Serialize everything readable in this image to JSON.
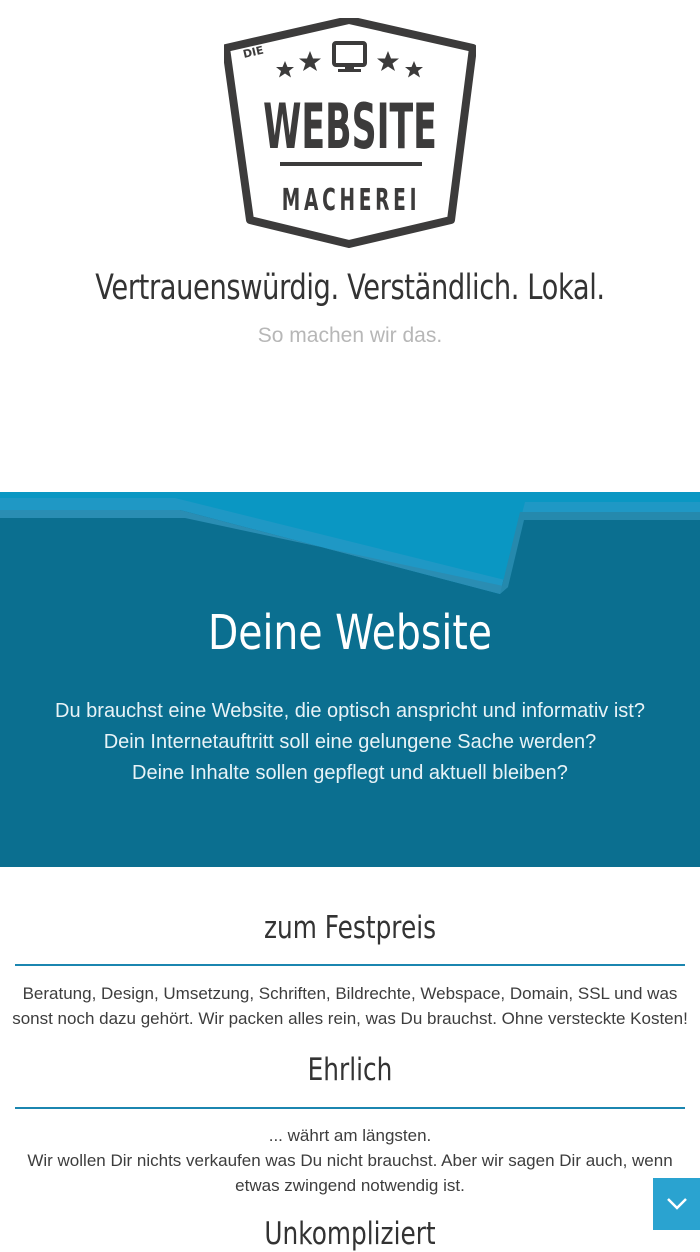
{
  "logo": {
    "small_word": "DIE",
    "main_word": "WEBSITE",
    "sub_word": "MACHEREI",
    "color": "#3c3b3b"
  },
  "hero": {
    "tagline": "Vertrauenswürdig. Verständlich. Lokal.",
    "subtitle": "So machen wir das."
  },
  "band": {
    "background": "#0b6f90",
    "title": "Deine Website",
    "lines": [
      "Du brauchst eine Website, die optisch anspricht und informativ ist?",
      "Dein Internetauftritt soll eine gelungene Sache werden?",
      "Deine Inhalte sollen gepflegt und aktuell bleiben?"
    ]
  },
  "features": [
    {
      "title": "zum Festpreis",
      "text": "Beratung, Design, Umsetzung, Schriften, Bildrechte, Webspace, Domain, SSL und was sonst noch dazu gehört. Wir packen alles rein, was Du brauchst. Ohne versteckte Kosten!"
    },
    {
      "title": "Ehrlich",
      "text_lines": [
        "... währt am längsten.",
        "Wir wollen Dir nichts verkaufen was Du nicht brauchst. Aber wir sagen Dir auch, wenn etwas zwingend notwendig ist."
      ]
    },
    {
      "title": "Unkompliziert"
    }
  ],
  "scroll_button": {
    "icon": "chevron-down-icon",
    "color": "#2aa3d0"
  }
}
